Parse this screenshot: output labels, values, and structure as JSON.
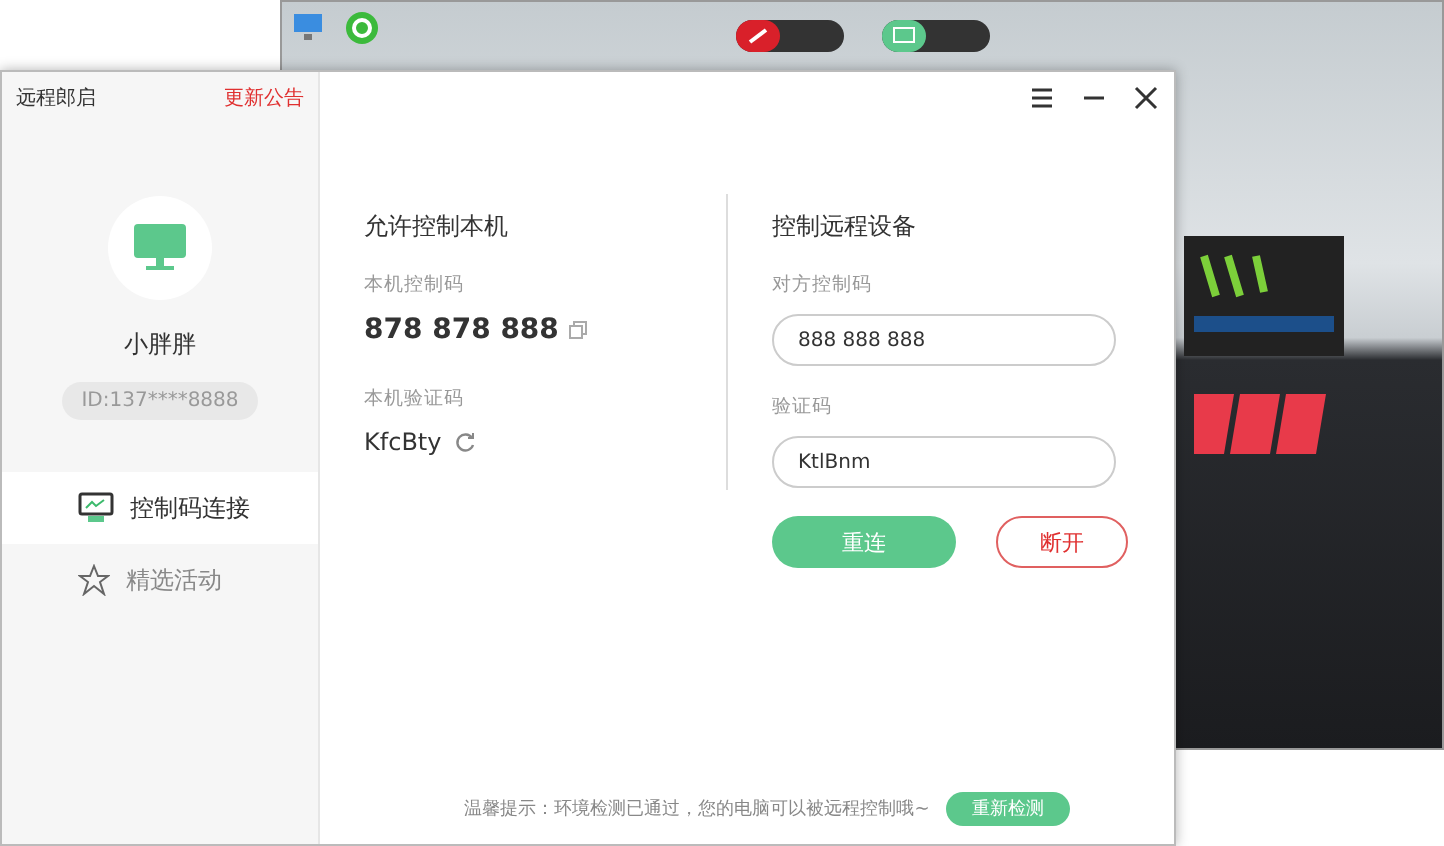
{
  "app": {
    "title": "远程郎启",
    "notice_link": "更新公告"
  },
  "profile": {
    "name": "小胖胖",
    "id": "ID:137****8888"
  },
  "nav": [
    {
      "label": "控制码连接",
      "selected": true,
      "kind": "monitor"
    },
    {
      "label": "精选活动",
      "selected": false,
      "kind": "star"
    }
  ],
  "local": {
    "title": "允许控制本机",
    "code_label": "本机控制码",
    "code": "878 878 888",
    "verify_label": "本机验证码",
    "verify": "KfcBty"
  },
  "remote": {
    "title": "控制远程设备",
    "fields": [
      {
        "label": "对方控制码",
        "value": "888 888 888"
      },
      {
        "label": "验证码",
        "value": "KtlBnm"
      }
    ],
    "buttons": [
      {
        "label": "重连",
        "kind": "primary"
      },
      {
        "label": "断开",
        "kind": "outline"
      }
    ]
  },
  "footer": {
    "tip": "温馨提示：环境检测已通过，您的电脑可以被远程控制哦~",
    "button": "重新检测"
  }
}
